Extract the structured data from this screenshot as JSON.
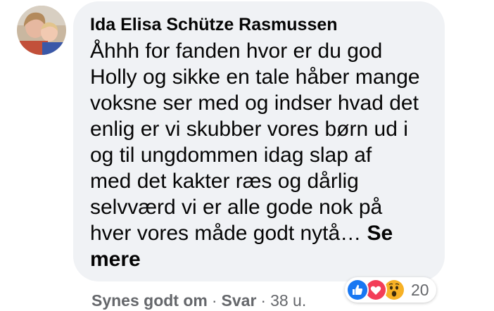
{
  "comment": {
    "author": "Ida Elisa Schütze Rasmussen",
    "text_lines": [
      "Åhhh for fanden hvor er du god",
      "Holly og sikke en tale håber mange",
      "voksne ser med og indser hvad det",
      "enlig er vi skubber vores børn ud i",
      "og til ungdommen idag slap af",
      "med det kakter ræs og dårlig",
      "selvværd vi er alle gode nok på",
      "hver vores måde godt nytå…",
      "mere"
    ],
    "see_more_first": "Se",
    "see_more_second": "mere"
  },
  "actions": {
    "like_label": "Synes godt om",
    "separator": "·",
    "reply_label": "Svar",
    "time": "38 u."
  },
  "reactions": {
    "icons": [
      "like-icon",
      "love-icon",
      "wow-icon"
    ],
    "count": "20",
    "colors": {
      "like": "#1877f2",
      "love": "#f33e58",
      "wow": "#f7b125"
    }
  }
}
